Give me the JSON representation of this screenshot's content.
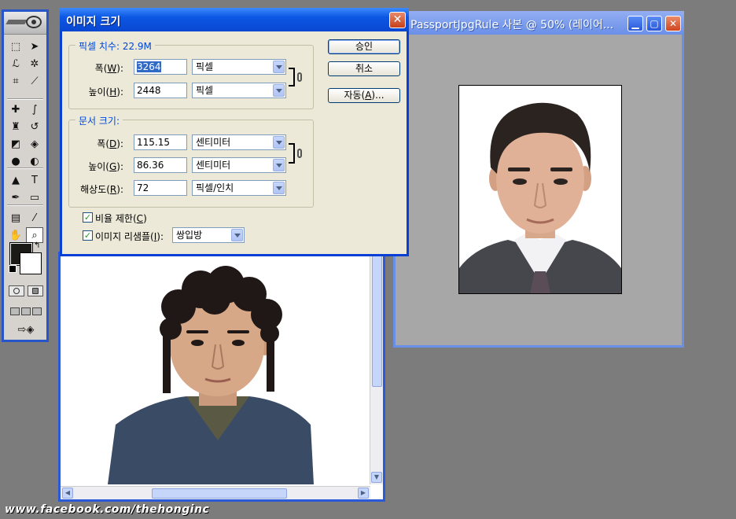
{
  "dialog": {
    "title": "이미지 크기",
    "pixel_group_label": "픽셀 치수: 22.9M",
    "width_label": [
      "폭(",
      "W",
      "):"
    ],
    "height_label": [
      "높이(",
      "H",
      "):"
    ],
    "pixel_width": "3264",
    "pixel_height": "2448",
    "pixel_unit": "픽셀",
    "doc_group_label": "문서 크기:",
    "doc_width_label": [
      "폭(",
      "D",
      "):"
    ],
    "doc_height_label": [
      "높이(",
      "G",
      "):"
    ],
    "resolution_label": [
      "해상도(",
      "R",
      "):"
    ],
    "doc_width": "115.15",
    "doc_height": "86.36",
    "doc_unit": "센티미터",
    "resolution": "72",
    "resolution_unit": "픽셀/인치",
    "ok_label": "승인",
    "cancel_label": "취소",
    "auto_label": [
      "자동(",
      "A",
      ")..."
    ],
    "constrain_label": [
      "비율 제한(",
      "C",
      ")"
    ],
    "constrain_checked": true,
    "resample_label": [
      "이미지 리샘플(",
      "I",
      "):"
    ],
    "resample_checked": true,
    "resample_method": "쌍입방",
    "close_glyph": "✕"
  },
  "passport_window": {
    "title": "PassportJpgRule 사본 @ 50% (레이어..."
  },
  "watermark": "www.facebook.com/thehonginc",
  "toolbox": {
    "tools": [
      {
        "name": "marquee-tool-icon",
        "glyph": "⬚"
      },
      {
        "name": "move-tool-icon",
        "glyph": "➤"
      },
      {
        "name": "lasso-tool-icon",
        "glyph": "ℒ"
      },
      {
        "name": "magic-wand-tool-icon",
        "glyph": "✲"
      },
      {
        "name": "crop-tool-icon",
        "glyph": "⌗"
      },
      {
        "name": "slice-tool-icon",
        "glyph": "⟋"
      },
      {
        "name": "healing-brush-tool-icon",
        "glyph": "✚"
      },
      {
        "name": "brush-tool-icon",
        "glyph": "∫"
      },
      {
        "name": "clone-stamp-tool-icon",
        "glyph": "♜"
      },
      {
        "name": "history-brush-tool-icon",
        "glyph": "↺"
      },
      {
        "name": "eraser-tool-icon",
        "glyph": "◩"
      },
      {
        "name": "paint-bucket-tool-icon",
        "glyph": "◈"
      },
      {
        "name": "blur-tool-icon",
        "glyph": "●"
      },
      {
        "name": "dodge-tool-icon",
        "glyph": "◐"
      },
      {
        "name": "path-selection-tool-icon",
        "glyph": "▲"
      },
      {
        "name": "type-tool-icon",
        "glyph": "T"
      },
      {
        "name": "pen-tool-icon",
        "glyph": "✒"
      },
      {
        "name": "shape-tool-icon",
        "glyph": "▭"
      },
      {
        "name": "notes-tool-icon",
        "glyph": "▤"
      },
      {
        "name": "eyedropper-tool-icon",
        "glyph": "⁄"
      },
      {
        "name": "hand-tool-icon",
        "glyph": "✋"
      },
      {
        "name": "zoom-tool-icon",
        "glyph": "⌕"
      }
    ]
  },
  "colors": {
    "dialog_title_bar": "#0a47d0",
    "foreground": "#1c1a17",
    "background": "#ffffff"
  }
}
